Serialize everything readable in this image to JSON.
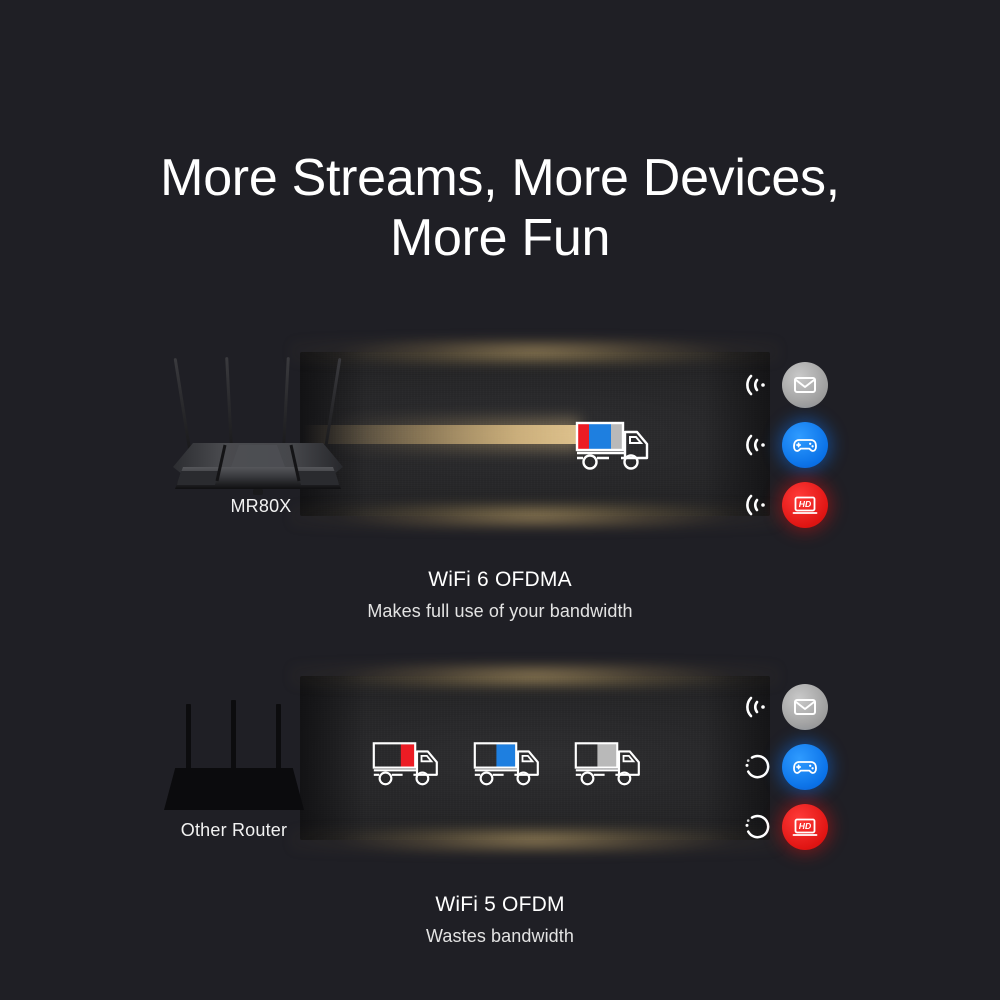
{
  "page": {
    "background_color": "#1f1f25",
    "title_line1": "More Streams, More Devices,",
    "title_line2": "More Fun"
  },
  "panels": [
    {
      "id": "wifi6",
      "router": {
        "name": "MR80X",
        "label": "MR80X",
        "antennas": 4,
        "style": "mr80x"
      },
      "beam": {
        "visible": true,
        "color": "#d6b478",
        "description": "single wide gold data beam"
      },
      "trucks": [
        {
          "name": "full-load-truck",
          "segments": [
            {
              "color": "#ec1c24",
              "width_pct": 22,
              "label": "mail"
            },
            {
              "color": "#1e7fe0",
              "width_pct": 44,
              "label": "game"
            },
            {
              "color": "#b9b9b9",
              "width_pct": 22,
              "label": "hd-video"
            }
          ],
          "fill_pct": 88
        }
      ],
      "devices": [
        {
          "name": "mail",
          "icon": "envelope-icon",
          "color": "#a0a0a0",
          "status": "connected",
          "status_icon": "wifi-signal-icon"
        },
        {
          "name": "game",
          "icon": "gamepad-icon",
          "color": "#0a72e8",
          "status": "connected",
          "status_icon": "wifi-signal-icon"
        },
        {
          "name": "hd-video",
          "icon": "hd-monitor-icon",
          "color": "#e01513",
          "status": "connected",
          "status_icon": "wifi-signal-icon"
        }
      ],
      "caption_main": "WiFi 6 OFDMA",
      "caption_sub": "Makes full use of your bandwidth"
    },
    {
      "id": "wifi5",
      "router": {
        "name": "Other Router",
        "label": "Other Router",
        "antennas": 3,
        "style": "other"
      },
      "beam": {
        "visible": false,
        "color": "",
        "description": "no beam"
      },
      "trucks": [
        {
          "name": "mail-truck",
          "segments": [
            {
              "color": "#ec1c24",
              "width_pct": 18,
              "label": "mail"
            }
          ],
          "fill_pct": 18
        },
        {
          "name": "game-truck",
          "segments": [
            {
              "color": "#1e7fe0",
              "width_pct": 30,
              "label": "game"
            }
          ],
          "fill_pct": 30
        },
        {
          "name": "video-truck",
          "segments": [
            {
              "color": "#b9b9b9",
              "width_pct": 30,
              "label": "hd-video"
            }
          ],
          "fill_pct": 30
        }
      ],
      "devices": [
        {
          "name": "mail",
          "icon": "envelope-icon",
          "color": "#a0a0a0",
          "status": "connected",
          "status_icon": "wifi-signal-icon"
        },
        {
          "name": "game",
          "icon": "gamepad-icon",
          "color": "#0a72e8",
          "status": "buffering",
          "status_icon": "loading-spinner-icon"
        },
        {
          "name": "hd-video",
          "icon": "hd-monitor-icon",
          "color": "#e01513",
          "status": "buffering",
          "status_icon": "loading-spinner-icon"
        }
      ],
      "caption_main": "WiFi 5 OFDM",
      "caption_sub": "Wastes bandwidth"
    }
  ],
  "icon_labels": {
    "hd_text": "HD"
  },
  "colors": {
    "gold_glow": "#d6b478",
    "panel_surface": "#2a2a2c",
    "red": "#ec1c24",
    "blue": "#1e7fe0",
    "gray": "#b9b9b9",
    "text_primary": "#ffffff",
    "text_secondary": "#e3e3e3"
  }
}
